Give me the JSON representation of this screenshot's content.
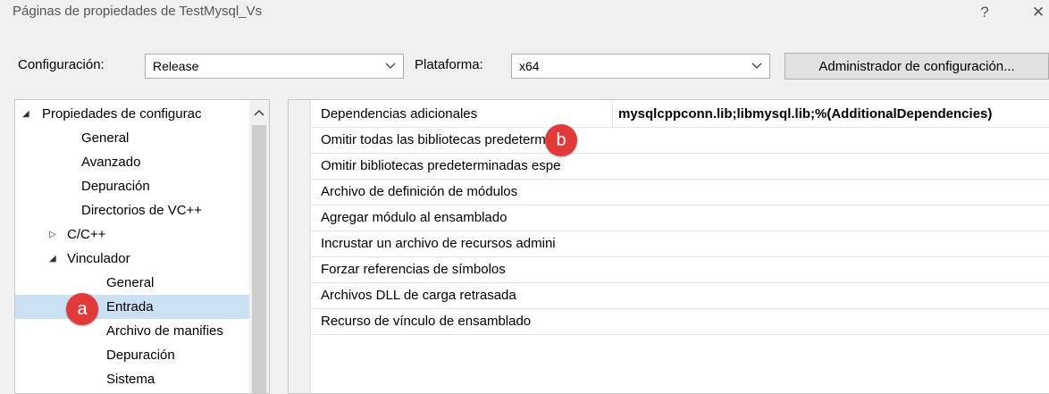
{
  "window": {
    "title": "Páginas de propiedades de TestMysql_Vs",
    "help": "?",
    "close": "✕"
  },
  "toolbar": {
    "config_label": "Configuración:",
    "config_value": "Release",
    "platform_label": "Plataforma:",
    "platform_value": "x64",
    "manager_button": "Administrador de configuración..."
  },
  "tree": {
    "items": [
      {
        "label": "Propiedades de configurac",
        "expander": "◢"
      },
      {
        "label": "General"
      },
      {
        "label": "Avanzado"
      },
      {
        "label": "Depuración"
      },
      {
        "label": "Directorios de VC++"
      },
      {
        "label": "C/C++",
        "expander": "▷"
      },
      {
        "label": "Vinculador",
        "expander": "◢"
      },
      {
        "label": "General"
      },
      {
        "label": "Entrada",
        "selected": true
      },
      {
        "label": "Archivo de manifies"
      },
      {
        "label": "Depuración"
      },
      {
        "label": "Sistema"
      }
    ]
  },
  "properties": [
    {
      "name": "Dependencias adicionales",
      "value": "mysqlcppconn.lib;libmysql.lib;%(AdditionalDependencies)"
    },
    {
      "name": "Omitir todas las bibliotecas predetermir",
      "value": ""
    },
    {
      "name": "Omitir bibliotecas predeterminadas espe",
      "value": ""
    },
    {
      "name": "Archivo de definición de módulos",
      "value": ""
    },
    {
      "name": "Agregar módulo al ensamblado",
      "value": ""
    },
    {
      "name": "Incrustar un archivo de recursos admini",
      "value": ""
    },
    {
      "name": "Forzar referencias de símbolos",
      "value": ""
    },
    {
      "name": "Archivos DLL de carga retrasada",
      "value": ""
    },
    {
      "name": "Recurso de vínculo de ensamblado",
      "value": ""
    }
  ],
  "annotations": {
    "a": "a",
    "b": "b",
    "color": "#e23a3a"
  }
}
